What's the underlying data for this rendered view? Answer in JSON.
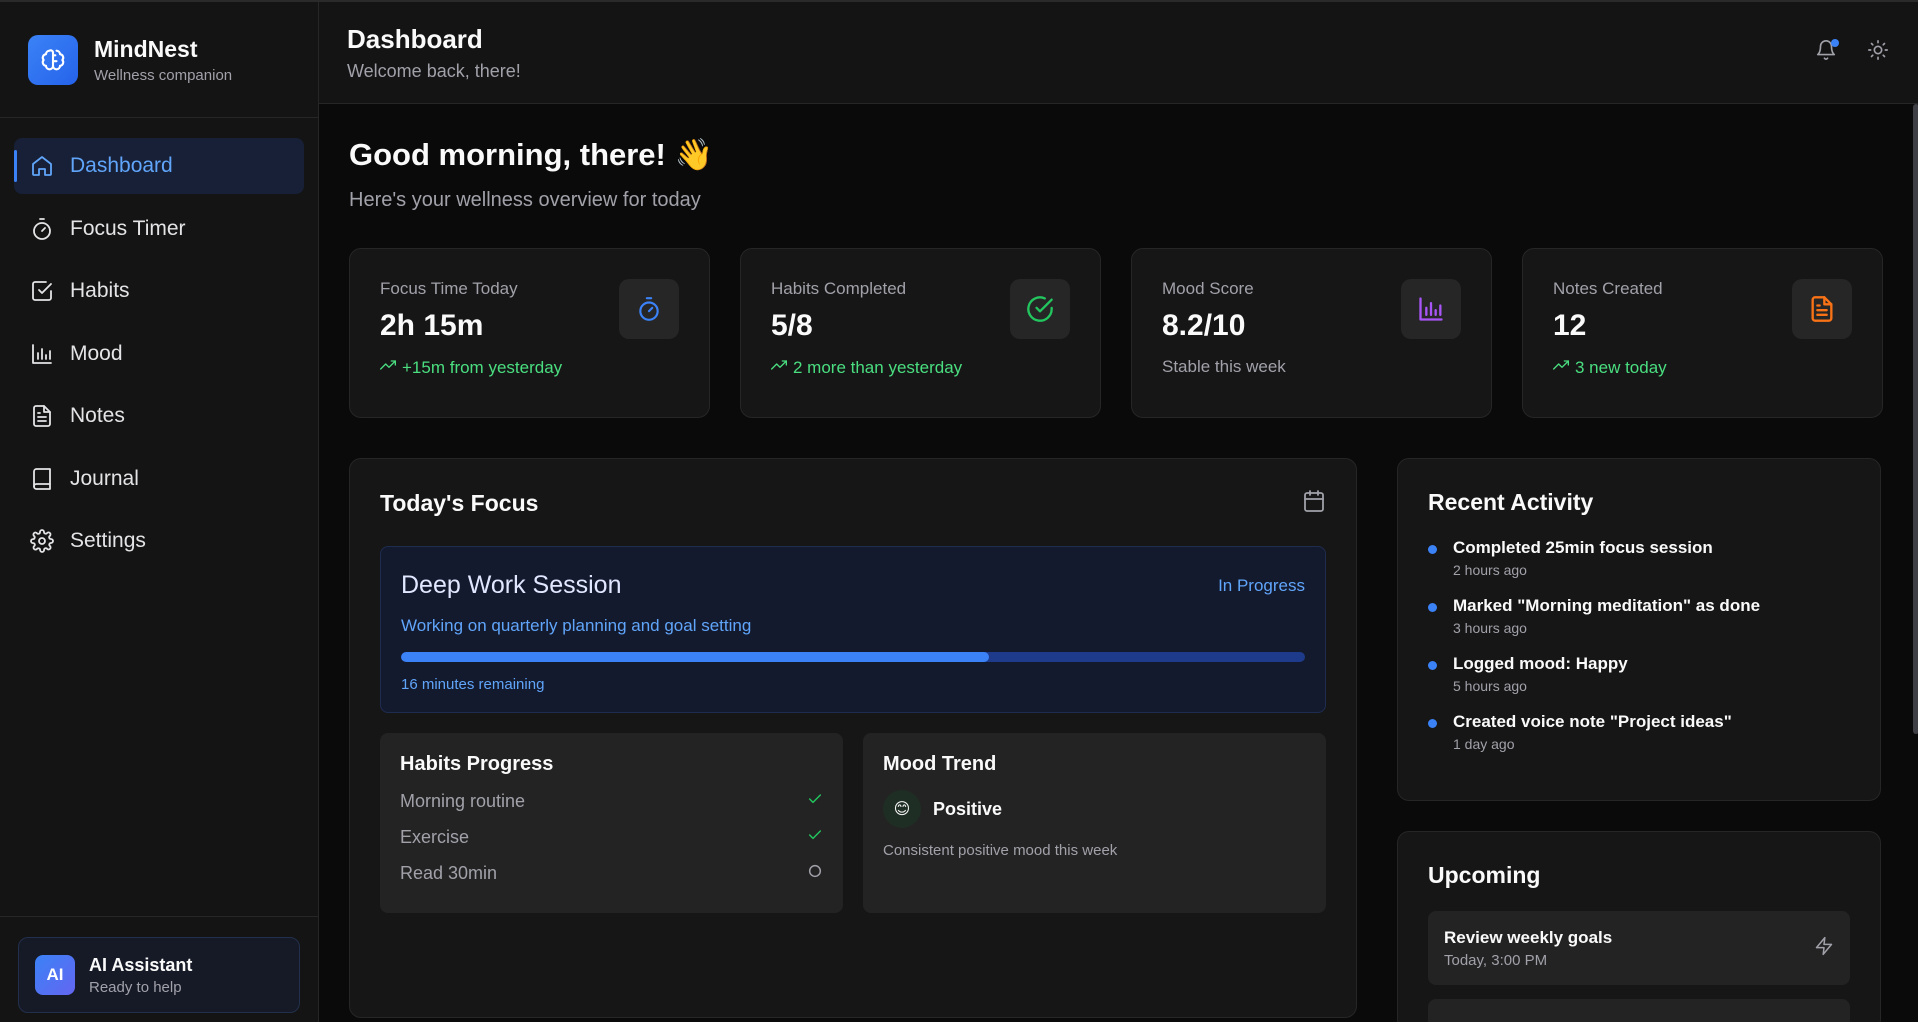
{
  "brand": {
    "name": "MindNest",
    "tagline": "Wellness companion"
  },
  "sidebar": {
    "items": [
      {
        "label": "Dashboard",
        "icon": "home-icon",
        "active": true
      },
      {
        "label": "Focus Timer",
        "icon": "timer-icon"
      },
      {
        "label": "Habits",
        "icon": "checkbox-icon"
      },
      {
        "label": "Mood",
        "icon": "bar-chart-icon"
      },
      {
        "label": "Notes",
        "icon": "document-icon"
      },
      {
        "label": "Journal",
        "icon": "book-icon"
      },
      {
        "label": "Settings",
        "icon": "gear-icon"
      }
    ]
  },
  "assistant": {
    "badge": "AI",
    "title": "AI Assistant",
    "subtitle": "Ready to help"
  },
  "header": {
    "title": "Dashboard",
    "subtitle": "Welcome back, there!"
  },
  "greeting": {
    "title": "Good morning, there! 👋",
    "subtitle": "Here's your wellness overview for today"
  },
  "stats": [
    {
      "label": "Focus Time Today",
      "value": "2h 15m",
      "change": "+15m from yesterday",
      "icon": "timer-icon",
      "color": "#3b82f6",
      "trend": true
    },
    {
      "label": "Habits Completed",
      "value": "5/8",
      "change": "2 more than yesterday",
      "icon": "check-circle-icon",
      "color": "#22c55e",
      "trend": true
    },
    {
      "label": "Mood Score",
      "value": "8.2/10",
      "change": "Stable this week",
      "icon": "bar-chart-icon",
      "color": "#a855f7",
      "trend": false
    },
    {
      "label": "Notes Created",
      "value": "12",
      "change": "3 new today",
      "icon": "document-icon",
      "color": "#f97316",
      "trend": true
    }
  ],
  "focus": {
    "title": "Today's Focus",
    "session": {
      "title": "Deep Work Session",
      "status": "In Progress",
      "description": "Working on quarterly planning and goal setting",
      "progress": 0.65,
      "remaining": "16 minutes remaining"
    },
    "habits": {
      "title": "Habits Progress",
      "items": [
        {
          "label": "Morning routine",
          "done": true
        },
        {
          "label": "Exercise",
          "done": true
        },
        {
          "label": "Read 30min",
          "done": false
        }
      ]
    },
    "mood": {
      "title": "Mood Trend",
      "emoji": "😊",
      "label": "Positive",
      "description": "Consistent positive mood this week"
    }
  },
  "activity": {
    "title": "Recent Activity",
    "items": [
      {
        "title": "Completed 25min focus session",
        "time": "2 hours ago"
      },
      {
        "title": "Marked \"Morning meditation\" as done",
        "time": "3 hours ago"
      },
      {
        "title": "Logged mood: Happy",
        "time": "5 hours ago"
      },
      {
        "title": "Created voice note \"Project ideas\"",
        "time": "1 day ago"
      }
    ]
  },
  "upcoming": {
    "title": "Upcoming",
    "items": [
      {
        "title": "Review weekly goals",
        "time": "Today, 3:00 PM"
      }
    ]
  }
}
